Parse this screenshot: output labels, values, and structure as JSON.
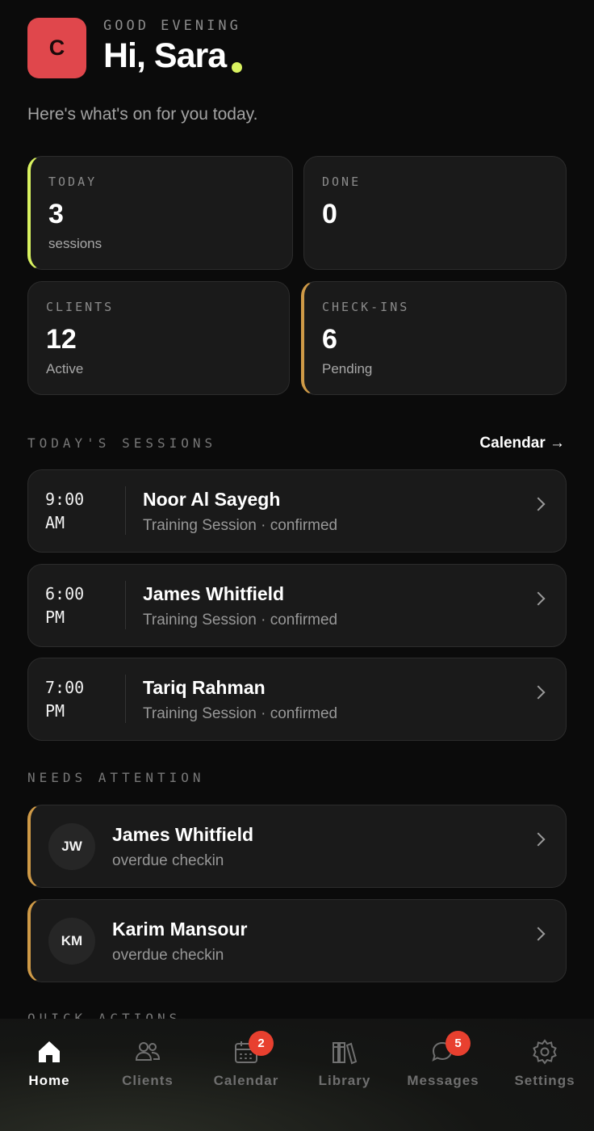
{
  "header": {
    "avatar_initial": "C",
    "greeting": "GOOD EVENING",
    "title": "Hi, Sara",
    "subtitle": "Here's what's on for you today."
  },
  "stats": [
    {
      "label": "TODAY",
      "value": "3",
      "sub": "sessions"
    },
    {
      "label": "DONE",
      "value": "0",
      "sub": ""
    },
    {
      "label": "CLIENTS",
      "value": "12",
      "sub": "Active"
    },
    {
      "label": "CHECK-INS",
      "value": "6",
      "sub": "Pending"
    }
  ],
  "sessions": {
    "section_label": "TODAY'S SESSIONS",
    "calendar_link": "Calendar →",
    "items": [
      {
        "time": "9:00",
        "period": "AM",
        "name": "Noor Al Sayegh",
        "meta": "Training Session · confirmed"
      },
      {
        "time": "6:00",
        "period": "PM",
        "name": "James Whitfield",
        "meta": "Training Session · confirmed"
      },
      {
        "time": "7:00",
        "period": "PM",
        "name": "Tariq Rahman",
        "meta": "Training Session · confirmed"
      }
    ]
  },
  "attention": {
    "section_label": "NEEDS ATTENTION",
    "items": [
      {
        "initials": "JW",
        "name": "James Whitfield",
        "meta": "overdue checkin"
      },
      {
        "initials": "KM",
        "name": "Karim Mansour",
        "meta": "overdue checkin"
      }
    ]
  },
  "quick_actions": {
    "section_label": "QUICK ACTIONS"
  },
  "tabbar": {
    "items": [
      {
        "label": "Home",
        "icon": "home-icon",
        "active": true
      },
      {
        "label": "Clients",
        "icon": "clients-icon"
      },
      {
        "label": "Calendar",
        "icon": "calendar-icon",
        "badge": "2"
      },
      {
        "label": "Library",
        "icon": "library-icon"
      },
      {
        "label": "Messages",
        "icon": "messages-icon",
        "badge": "5"
      },
      {
        "label": "Settings",
        "icon": "gear-icon"
      }
    ]
  },
  "colors": {
    "accent_lime": "#d9f260",
    "accent_amber": "#cf9a47",
    "avatar_red": "#e0474c",
    "badge_red": "#e8402f"
  }
}
